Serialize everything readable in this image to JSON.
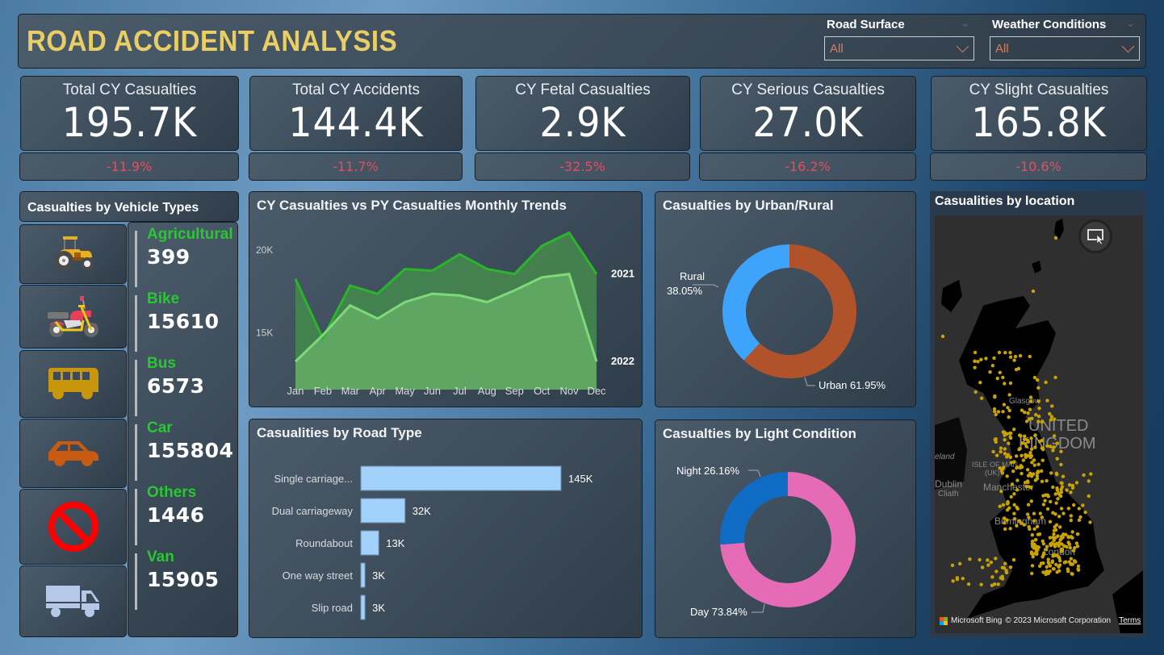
{
  "header": {
    "title": "ROAD ACCIDENT ANALYSIS",
    "slicers": [
      {
        "label": "Road Surface",
        "value": "All"
      },
      {
        "label": "Weather Conditions",
        "value": "All"
      }
    ]
  },
  "kpis": [
    {
      "label": "Total CY Casualties",
      "value": "195.7K",
      "delta": "-11.9%"
    },
    {
      "label": "Total CY Accidents",
      "value": "144.4K",
      "delta": "-11.7%"
    },
    {
      "label": "CY Fetal Casualties",
      "value": "2.9K",
      "delta": "-32.5%"
    },
    {
      "label": "CY Serious Casualties",
      "value": "27.0K",
      "delta": "-16.2%"
    },
    {
      "label": "CY Slight Casualties",
      "value": "165.8K",
      "delta": "-10.6%"
    }
  ],
  "colors": {
    "title": "#e8ce64",
    "delta_negative": "#e05060",
    "vehicle_name": "#29c832",
    "cy_line": "#7fd97b",
    "py_line": "#2ab52a",
    "bar": "#a2d1fb",
    "urban": "#b0532a",
    "rural": "#3ea3fb",
    "day": "#e66bb7",
    "night": "#0f6bc3",
    "map_dot": "#c9a400"
  },
  "vehicles": {
    "title": "Casualties by Vehicle Types",
    "items": [
      {
        "name": "Agricultural",
        "count": "399",
        "icon": "tractor-icon"
      },
      {
        "name": "Bike",
        "count": "15610",
        "icon": "motorbike-icon"
      },
      {
        "name": "Bus",
        "count": "6573",
        "icon": "bus-icon"
      },
      {
        "name": "Car",
        "count": "155804",
        "icon": "car-icon"
      },
      {
        "name": "Others",
        "count": "1446",
        "icon": "prohibited-icon"
      },
      {
        "name": "Van",
        "count": "15905",
        "icon": "van-icon"
      }
    ]
  },
  "map": {
    "title": "Casualities by location",
    "labels": {
      "country1": "UNITED",
      "country2": "KINGDOM",
      "glasgow": "Glasgow",
      "iom": "ISLE OF MAN",
      "iom2": "(UK)",
      "manchester": "Manchester",
      "birmingham": "Birmingham",
      "london": "London",
      "dublin": "Dublin",
      "ireland": "eland",
      "cliath": "Cliath"
    },
    "attribution": "Microsoft Bing",
    "copyright": "© 2023 Microsoft Corporation",
    "terms": "Terms"
  },
  "chart_data": [
    {
      "type": "area",
      "title": "CY Casualties vs PY Casualties Monthly Trends",
      "categories": [
        "Jan",
        "Feb",
        "Mar",
        "Apr",
        "May",
        "Jun",
        "Jul",
        "Aug",
        "Sep",
        "Oct",
        "Nov",
        "Dec"
      ],
      "series": [
        {
          "name": "2021",
          "values": [
            18200,
            14600,
            17800,
            17300,
            18800,
            18700,
            19700,
            18800,
            18500,
            20200,
            21000,
            18500
          ]
        },
        {
          "name": "2022",
          "values": [
            13200,
            14800,
            16600,
            15800,
            16800,
            17300,
            17200,
            16800,
            17500,
            18300,
            18500,
            13200
          ]
        }
      ],
      "yticks": [
        "15K",
        "20K"
      ],
      "ytick_values": [
        15000,
        20000
      ],
      "ylim": [
        11500,
        22000
      ],
      "grid": false
    },
    {
      "type": "bar",
      "orientation": "horizontal",
      "title": "Casualities by Road Type",
      "categories": [
        "Single carriage...",
        "Dual carriageway",
        "Roundabout",
        "One way street",
        "Slip road"
      ],
      "values": [
        145000,
        32000,
        13000,
        3000,
        3000
      ],
      "data_labels": [
        "145K",
        "32K",
        "13K",
        "3K",
        "3K"
      ]
    },
    {
      "type": "pie",
      "donut": true,
      "title": "Casualties by Urban/Rural",
      "slices": [
        {
          "label": "Urban",
          "value": 61.95,
          "data_label": "Urban 61.95%"
        },
        {
          "label": "Rural",
          "value": 38.05,
          "data_label": "Rural 38.05%"
        }
      ]
    },
    {
      "type": "pie",
      "donut": true,
      "title": "Casualties by Light Condition",
      "slices": [
        {
          "label": "Day",
          "value": 73.84,
          "data_label": "Day 73.84%"
        },
        {
          "label": "Night",
          "value": 26.16,
          "data_label": "Night 26.16%"
        }
      ]
    }
  ]
}
